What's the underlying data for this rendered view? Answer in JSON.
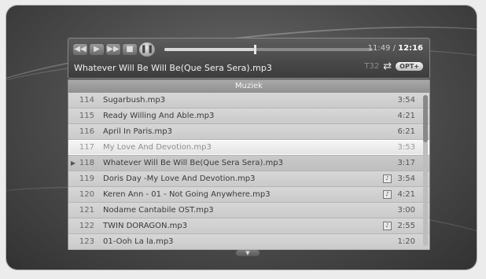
{
  "player": {
    "controls": [
      {
        "name": "rewind",
        "glyph": "◀◀"
      },
      {
        "name": "play",
        "glyph": "▶"
      },
      {
        "name": "fast-forward",
        "glyph": "▶▶"
      },
      {
        "name": "stop",
        "glyph": "■"
      },
      {
        "name": "pause",
        "glyph": "❚❚"
      }
    ],
    "progress_fraction": 0.43,
    "time_elapsed": "11:49",
    "time_separator": " / ",
    "time_total": "12:16",
    "now_playing": "Whatever Will Be Will Be(Que Sera Sera).mp3",
    "track_number": "T32",
    "repeat_icon": "repeat-icon",
    "opt_label": "OPT+"
  },
  "playlist": {
    "title": "Muziek",
    "rows": [
      {
        "num": "114",
        "name": "Sugarbush.mp3",
        "duration": "3:54"
      },
      {
        "num": "115",
        "name": "Ready Willing And Able.mp3",
        "duration": "4:21"
      },
      {
        "num": "116",
        "name": "April In Paris.mp3",
        "duration": "6:21"
      },
      {
        "num": "117",
        "name": "My Love And Devotion.mp3",
        "duration": "3:53",
        "selected": true
      },
      {
        "num": "118",
        "name": "Whatever Will Be Will Be(Que Sera Sera).mp3",
        "duration": "3:17",
        "playing": true
      },
      {
        "num": "119",
        "name": "Doris Day -My Love And Devotion.mp3",
        "duration": "3:54",
        "lyrics": true
      },
      {
        "num": "120",
        "name": "Keren Ann - 01 - Not Going Anywhere.mp3",
        "duration": "4:21",
        "lyrics": true
      },
      {
        "num": "121",
        "name": "Nodame Cantabile OST.mp3",
        "duration": "3:00"
      },
      {
        "num": "122",
        "name": "TWIN DORAGON.mp3",
        "duration": "2:55",
        "lyrics": true
      },
      {
        "num": "123",
        "name": "01-Ooh La la.mp3",
        "duration": "1:20"
      }
    ],
    "scroll_fraction": 0.0
  },
  "colors": {
    "panel_bg": "#cdcdcd",
    "header_bg": "#3c3c3c",
    "accent": "#ffffff"
  }
}
